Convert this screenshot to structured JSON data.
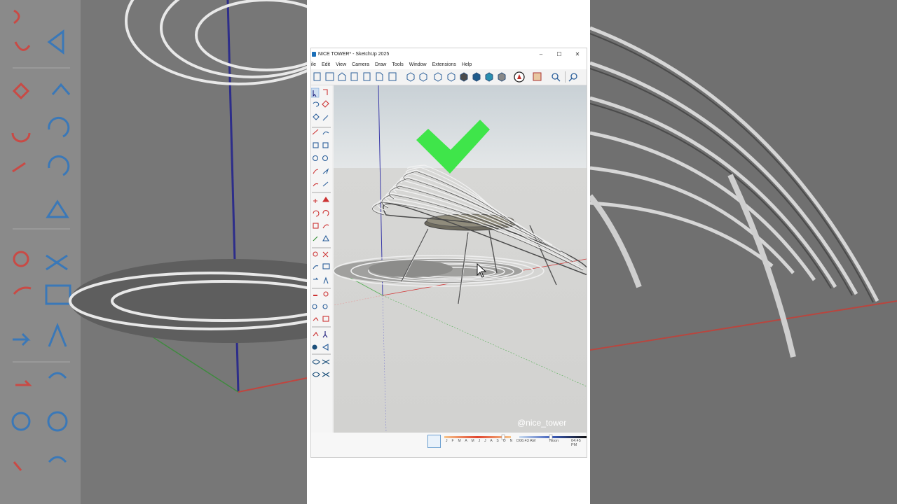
{
  "window": {
    "title": "NICE TOWER* - SketchUp 2025",
    "controls": {
      "minimize": "–",
      "maximize": "☐",
      "close": "✕"
    }
  },
  "menu": [
    "File",
    "Edit",
    "View",
    "Camera",
    "Draw",
    "Tools",
    "Window",
    "Extensions",
    "Help"
  ],
  "menu_visible_first": "ile",
  "watermark": "@nice_tower",
  "shadow_settings": {
    "months": "J F M A M J J A S O N D",
    "time_start": "06:43 AM",
    "time_noon": "Noon",
    "time_end": "04:45 PM"
  },
  "colors": {
    "checkmark": "#3fe54a",
    "axis_red": "#d23a3a",
    "axis_green": "#55b055",
    "axis_blue": "#3a3aa8"
  },
  "icons": {
    "toolbar": [
      "new-icon",
      "section-icon",
      "house-icon",
      "shapes-icon",
      "paste-icon",
      "document-icon",
      "page-icon",
      "iso-view-icon",
      "top-view-icon",
      "front-view-icon",
      "right-view-icon",
      "back-view-icon",
      "left-view-icon",
      "bottom-view-icon",
      "shaded-icon",
      "warehouse-icon",
      "extension-icon",
      "zoom-icon",
      "zoom-window-icon"
    ],
    "left": [
      "select-icon",
      "paint-icon",
      "lasso-icon",
      "eraser-icon",
      "tag-icon",
      "line-icon",
      "freehand-icon",
      "rectangle-icon",
      "rotated-rect-icon",
      "circle-icon",
      "polygon-icon",
      "arc-icon",
      "pie-icon",
      "move-icon",
      "pushpull-icon",
      "rotate-icon",
      "followme-icon",
      "scale-icon",
      "offset-icon",
      "tape-icon",
      "text-icon",
      "protractor-icon",
      "axes-icon",
      "dimension-icon",
      "3dtext-icon",
      "orbit-icon",
      "pan-icon",
      "zoom-icon",
      "zoomext-icon",
      "prev-view-icon",
      "position-camera-icon",
      "walk-icon",
      "lookaround-icon",
      "section-plane-icon",
      "sandbox-from-contours-icon",
      "sandbox-scratch-icon",
      "smoove-icon",
      "stamp-icon"
    ]
  }
}
